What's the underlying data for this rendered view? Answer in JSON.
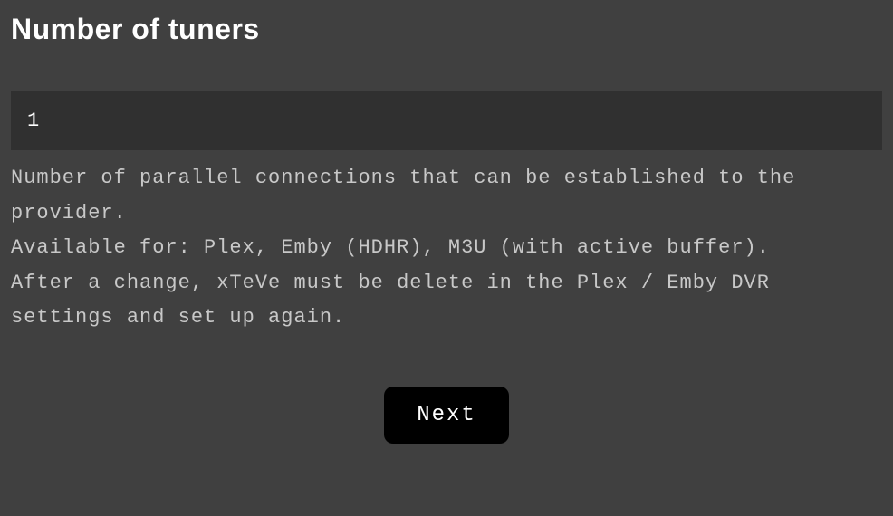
{
  "page": {
    "title": "Number of tuners"
  },
  "form": {
    "tuner_value": "1",
    "description": "Number of parallel connections that can be established to the provider.\nAvailable for: Plex, Emby (HDHR), M3U (with active buffer).\nAfter a change, xTeVe must be delete in the Plex / Emby DVR settings and set up again."
  },
  "buttons": {
    "next_label": "Next"
  }
}
